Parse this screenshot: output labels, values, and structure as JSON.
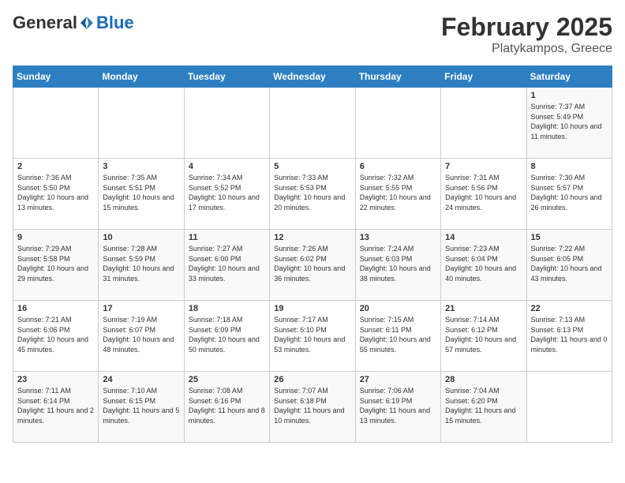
{
  "header": {
    "logo_general": "General",
    "logo_blue": "Blue",
    "title": "February 2025",
    "subtitle": "Platykampos, Greece"
  },
  "days_of_week": [
    "Sunday",
    "Monday",
    "Tuesday",
    "Wednesday",
    "Thursday",
    "Friday",
    "Saturday"
  ],
  "weeks": [
    [
      {
        "day": "",
        "info": ""
      },
      {
        "day": "",
        "info": ""
      },
      {
        "day": "",
        "info": ""
      },
      {
        "day": "",
        "info": ""
      },
      {
        "day": "",
        "info": ""
      },
      {
        "day": "",
        "info": ""
      },
      {
        "day": "1",
        "info": "Sunrise: 7:37 AM\nSunset: 5:49 PM\nDaylight: 10 hours and 11 minutes."
      }
    ],
    [
      {
        "day": "2",
        "info": "Sunrise: 7:36 AM\nSunset: 5:50 PM\nDaylight: 10 hours and 13 minutes."
      },
      {
        "day": "3",
        "info": "Sunrise: 7:35 AM\nSunset: 5:51 PM\nDaylight: 10 hours and 15 minutes."
      },
      {
        "day": "4",
        "info": "Sunrise: 7:34 AM\nSunset: 5:52 PM\nDaylight: 10 hours and 17 minutes."
      },
      {
        "day": "5",
        "info": "Sunrise: 7:33 AM\nSunset: 5:53 PM\nDaylight: 10 hours and 20 minutes."
      },
      {
        "day": "6",
        "info": "Sunrise: 7:32 AM\nSunset: 5:55 PM\nDaylight: 10 hours and 22 minutes."
      },
      {
        "day": "7",
        "info": "Sunrise: 7:31 AM\nSunset: 5:56 PM\nDaylight: 10 hours and 24 minutes."
      },
      {
        "day": "8",
        "info": "Sunrise: 7:30 AM\nSunset: 5:57 PM\nDaylight: 10 hours and 26 minutes."
      }
    ],
    [
      {
        "day": "9",
        "info": "Sunrise: 7:29 AM\nSunset: 5:58 PM\nDaylight: 10 hours and 29 minutes."
      },
      {
        "day": "10",
        "info": "Sunrise: 7:28 AM\nSunset: 5:59 PM\nDaylight: 10 hours and 31 minutes."
      },
      {
        "day": "11",
        "info": "Sunrise: 7:27 AM\nSunset: 6:00 PM\nDaylight: 10 hours and 33 minutes."
      },
      {
        "day": "12",
        "info": "Sunrise: 7:26 AM\nSunset: 6:02 PM\nDaylight: 10 hours and 36 minutes."
      },
      {
        "day": "13",
        "info": "Sunrise: 7:24 AM\nSunset: 6:03 PM\nDaylight: 10 hours and 38 minutes."
      },
      {
        "day": "14",
        "info": "Sunrise: 7:23 AM\nSunset: 6:04 PM\nDaylight: 10 hours and 40 minutes."
      },
      {
        "day": "15",
        "info": "Sunrise: 7:22 AM\nSunset: 6:05 PM\nDaylight: 10 hours and 43 minutes."
      }
    ],
    [
      {
        "day": "16",
        "info": "Sunrise: 7:21 AM\nSunset: 6:06 PM\nDaylight: 10 hours and 45 minutes."
      },
      {
        "day": "17",
        "info": "Sunrise: 7:19 AM\nSunset: 6:07 PM\nDaylight: 10 hours and 48 minutes."
      },
      {
        "day": "18",
        "info": "Sunrise: 7:18 AM\nSunset: 6:09 PM\nDaylight: 10 hours and 50 minutes."
      },
      {
        "day": "19",
        "info": "Sunrise: 7:17 AM\nSunset: 6:10 PM\nDaylight: 10 hours and 53 minutes."
      },
      {
        "day": "20",
        "info": "Sunrise: 7:15 AM\nSunset: 6:11 PM\nDaylight: 10 hours and 55 minutes."
      },
      {
        "day": "21",
        "info": "Sunrise: 7:14 AM\nSunset: 6:12 PM\nDaylight: 10 hours and 57 minutes."
      },
      {
        "day": "22",
        "info": "Sunrise: 7:13 AM\nSunset: 6:13 PM\nDaylight: 11 hours and 0 minutes."
      }
    ],
    [
      {
        "day": "23",
        "info": "Sunrise: 7:11 AM\nSunset: 6:14 PM\nDaylight: 11 hours and 2 minutes."
      },
      {
        "day": "24",
        "info": "Sunrise: 7:10 AM\nSunset: 6:15 PM\nDaylight: 11 hours and 5 minutes."
      },
      {
        "day": "25",
        "info": "Sunrise: 7:08 AM\nSunset: 6:16 PM\nDaylight: 11 hours and 8 minutes."
      },
      {
        "day": "26",
        "info": "Sunrise: 7:07 AM\nSunset: 6:18 PM\nDaylight: 11 hours and 10 minutes."
      },
      {
        "day": "27",
        "info": "Sunrise: 7:06 AM\nSunset: 6:19 PM\nDaylight: 11 hours and 13 minutes."
      },
      {
        "day": "28",
        "info": "Sunrise: 7:04 AM\nSunset: 6:20 PM\nDaylight: 11 hours and 15 minutes."
      },
      {
        "day": "",
        "info": ""
      }
    ]
  ]
}
